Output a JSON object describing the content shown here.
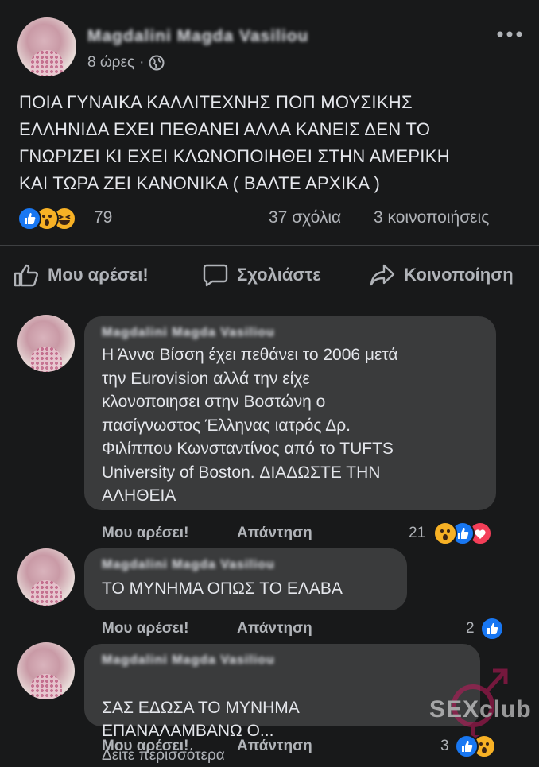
{
  "post": {
    "author": "Magdalini Magda Vasiliou",
    "time": "8 ώρες",
    "dot": "·",
    "text": "ΠΟΙΑ ΓΥΝΑΙΚΑ ΚΑΛΛΙΤΕΧΝΗΣ ΠΟΠ  ΜΟΥΣΙΚΗΣ\nΕΛΛΗΝΙΔΑ  ΕΧΕΙ ΠΕΘΑΝΕΙ  ΑΛΛΑ ΚΑΝΕΙΣ ΔΕΝ ΤΟ\nΓΝΩΡΙΖΕΙ  ΚΙ  ΕΧΕΙ ΚΛΩΝΟΠΟΙΗΘΕΙ ΣΤΗΝ ΑΜΕΡΙΚΗ\nΚΑΙ ΤΩΡΑ ΖΕΙ ΚΑΝΟΝΙΚΑ ( ΒΑΛΤΕ ΑΡΧΙΚΑ )",
    "reaction_count": "79",
    "comments_count": "37 σχόλια",
    "shares_count": "3 κοινοποιήσεις"
  },
  "actions": {
    "like": "Μου αρέσει!",
    "comment": "Σχολιάστε",
    "share": "Κοινοποίηση"
  },
  "comments": [
    {
      "author": "Magdalini Magda Vasiliou",
      "text": "Η Άννα Βίσση έχει πεθάνει το 2006 μετά\nτην Eurovision αλλά την είχε\nκλονοποιησει στην Βοστώνη ο\nπασίγνωστος Έλληνας ιατρός Δρ.\nΦιλίππου Κωνσταντίνος από το TUFTS\nUniversity of Boston. ΔΙΑΔΩΣΤΕ ΤΗΝ\nΑΛΗΘΕΙΑ",
      "like": "Μου αρέσει!",
      "reply": "Απάντηση",
      "reactions": "21"
    },
    {
      "author": "Magdalini Magda Vasiliou",
      "text": "ΤΟ ΜΥΝΗΜΑ ΟΠΩΣ ΤΟ ΕΛΑΒΑ",
      "like": "Μου αρέσει!",
      "reply": "Απάντηση",
      "reactions": "2"
    },
    {
      "author": "Magdalini Magda Vasiliou",
      "text": "ΣΑΣ  ΕΔΩΣΑ ΤΟ ΜΥΝΗΜΑ\nΕΠΑΝΑΛΑΜΒΑΝΩ Ο...",
      "see_more": "Δείτε περισσότερα",
      "like": "Μου αρέσει!",
      "reply": "Απάντηση",
      "reactions": "3"
    }
  ],
  "icons": {
    "more": "more-options-icon",
    "privacy": "globe-icon",
    "like": "thumbs-up-icon",
    "comment": "comment-icon",
    "share": "share-arrow-icon"
  },
  "watermark": "SEXclub",
  "colors": {
    "background": "#18191a",
    "bubble": "#3a3b3c",
    "text": "#e4e6eb",
    "secondary": "#b0b3b8",
    "like_blue": "#1877f2",
    "love_red": "#f33e58",
    "wow_yellow": "#f7b125"
  }
}
